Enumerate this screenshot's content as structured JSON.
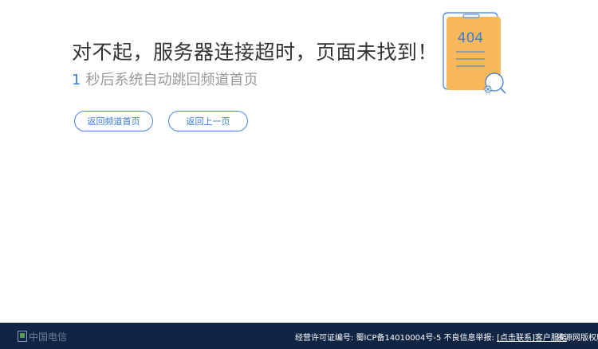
{
  "error": {
    "title": "对不起，服务器连接超时，页面未找到！",
    "countdown_number": "1",
    "countdown_text": "秒后系统自动跳回频道首页",
    "illustration_code": "404"
  },
  "buttons": {
    "home_label": "返回频道首页",
    "back_label": "返回上一页"
  },
  "footer": {
    "logo_alt": "中国电信",
    "license_prefix": "经营许可证编号: 蜀ICP备14010004号-5 不良信息举报: ",
    "report_link": "[点击联系]",
    "service_link": "客户服务",
    "scrolling_text": "资源网版权所有"
  },
  "colors": {
    "accent": "#3a7bd5",
    "footer_bg": "#0f2543",
    "card_fill": "#f9b95a"
  }
}
